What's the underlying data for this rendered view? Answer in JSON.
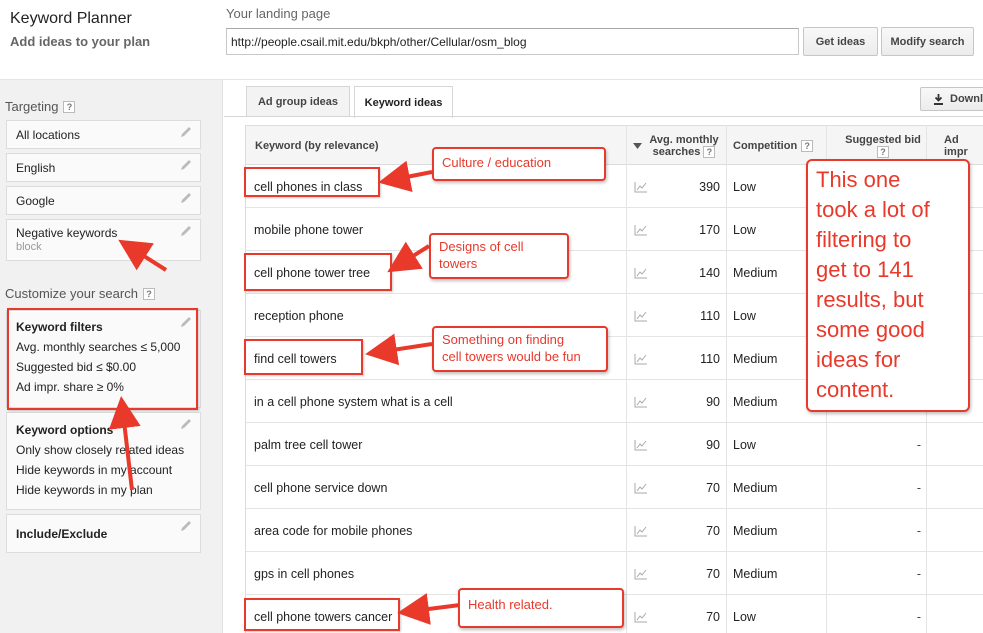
{
  "header": {
    "app_title": "Keyword Planner",
    "app_subtitle": "Add ideas to your plan",
    "landing_label": "Your landing page",
    "landing_url": "http://people.csail.mit.edu/bkph/other/Cellular/osm_blog",
    "get_ideas": "Get ideas",
    "modify_search": "Modify search"
  },
  "sidebar": {
    "targeting_title": "Targeting",
    "locations": "All locations",
    "language": "English",
    "network": "Google",
    "negative_title": "Negative keywords",
    "negative_value": "block",
    "customize_title": "Customize your search",
    "keyword_filters": {
      "title": "Keyword filters",
      "lines": [
        "Avg. monthly searches ≤ 5,000",
        "Suggested bid ≤ $0.00",
        "Ad impr. share ≥ 0%"
      ]
    },
    "keyword_options": {
      "title": "Keyword options",
      "lines": [
        "Only show closely related ideas",
        "Hide keywords in my account",
        "Hide keywords in my plan"
      ]
    },
    "include_exclude": "Include/Exclude"
  },
  "tabs": {
    "ad_group": "Ad group ideas",
    "keyword": "Keyword ideas",
    "download": "Downl"
  },
  "table": {
    "headers": {
      "keyword": "Keyword (by relevance)",
      "avg_line1": "Avg. monthly",
      "avg_line2": "searches",
      "competition": "Competition",
      "bid": "Suggested bid",
      "ad": "Ad impr"
    },
    "rows": [
      {
        "keyword": "cell phones in class",
        "avg": "390",
        "comp": "Low",
        "bid": ""
      },
      {
        "keyword": "mobile phone tower",
        "avg": "170",
        "comp": "Low",
        "bid": ""
      },
      {
        "keyword": "cell phone tower tree",
        "avg": "140",
        "comp": "Medium",
        "bid": ""
      },
      {
        "keyword": "reception phone",
        "avg": "110",
        "comp": "Low",
        "bid": ""
      },
      {
        "keyword": "find cell towers",
        "avg": "110",
        "comp": "Medium",
        "bid": ""
      },
      {
        "keyword": "in a cell phone system what is a cell",
        "avg": "90",
        "comp": "Medium",
        "bid": ""
      },
      {
        "keyword": "palm tree cell tower",
        "avg": "90",
        "comp": "Low",
        "bid": "-"
      },
      {
        "keyword": "cell phone service down",
        "avg": "70",
        "comp": "Medium",
        "bid": "-"
      },
      {
        "keyword": "area code for mobile phones",
        "avg": "70",
        "comp": "Medium",
        "bid": "-"
      },
      {
        "keyword": "gps in cell phones",
        "avg": "70",
        "comp": "Medium",
        "bid": "-"
      },
      {
        "keyword": "cell phone towers cancer",
        "avg": "70",
        "comp": "Low",
        "bid": "-"
      }
    ]
  },
  "annotations": {
    "culture": "Culture / education",
    "designs_1": "Designs of cell",
    "designs_2": "towers",
    "finding_1": "Something on finding",
    "finding_2": "cell towers would be fun",
    "health": "Health related.",
    "big": [
      "This one",
      "took a lot of",
      "filtering to",
      "get to 141",
      "results, but",
      "some good",
      "ideas for",
      "content."
    ]
  },
  "colors": {
    "annotation": "#e8392b",
    "sidebar_bg": "#f1f1f1"
  }
}
